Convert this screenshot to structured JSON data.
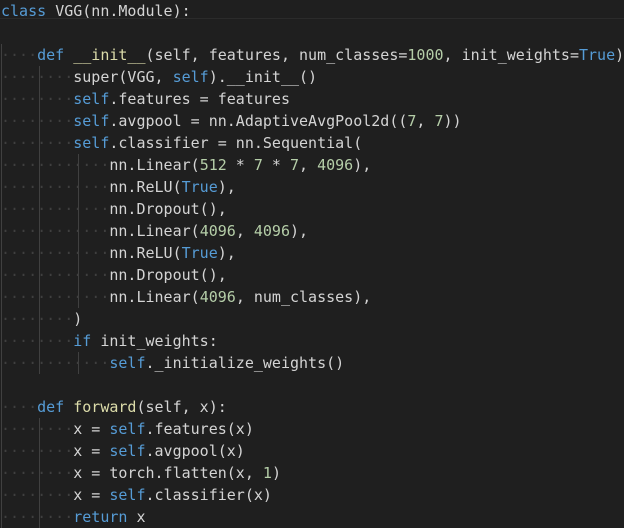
{
  "editor": {
    "app": "code-editor",
    "language": "python",
    "theme": "dark-plus",
    "background_color": "#1f1f1f",
    "default_text_color": "#d4d4d4",
    "colors": {
      "keyword": "#569cd6",
      "function": "#dcdcaa",
      "number": "#b5cea8",
      "attribute": "#9cdcfe",
      "plain": "#d4d4d4",
      "whitespace_dot": "#3f3f3f",
      "indent_guide": "#404040",
      "paren_yellow": "#d7ba7d"
    },
    "whitespace_char": "·",
    "indent_guide_columns": [
      0,
      4,
      8,
      12,
      16
    ],
    "line_count": 24
  },
  "code": {
    "lines": [
      {
        "indent": 0,
        "tokens": [
          {
            "t": "class",
            "c": "kw"
          },
          {
            "t": " ",
            "c": "pln"
          },
          {
            "t": "VGG",
            "c": "pln"
          },
          {
            "t": "(nn.Module):",
            "c": "pln"
          }
        ]
      },
      {
        "indent": 0,
        "tokens": []
      },
      {
        "indent": 4,
        "tokens": [
          {
            "t": "def",
            "c": "kw"
          },
          {
            "t": " ",
            "c": "pln"
          },
          {
            "t": "__init__",
            "c": "fn"
          },
          {
            "t": "(",
            "c": "pln"
          },
          {
            "t": "self",
            "c": "pln"
          },
          {
            "t": ", features, num_classes=",
            "c": "pln"
          },
          {
            "t": "1000",
            "c": "num"
          },
          {
            "t": ", init_weights=",
            "c": "pln"
          },
          {
            "t": "True",
            "c": "kw"
          },
          {
            "t": "):",
            "c": "pln"
          }
        ]
      },
      {
        "indent": 8,
        "tokens": [
          {
            "t": "super",
            "c": "pln"
          },
          {
            "t": "(VGG, ",
            "c": "pln"
          },
          {
            "t": "self",
            "c": "kw"
          },
          {
            "t": ").",
            "c": "pln"
          },
          {
            "t": "__init__",
            "c": "pln"
          },
          {
            "t": "()",
            "c": "pln"
          }
        ]
      },
      {
        "indent": 8,
        "tokens": [
          {
            "t": "self",
            "c": "kw"
          },
          {
            "t": ".features = features",
            "c": "pln"
          }
        ]
      },
      {
        "indent": 8,
        "tokens": [
          {
            "t": "self",
            "c": "kw"
          },
          {
            "t": ".avgpool = nn.AdaptiveAvgPool2d((",
            "c": "pln"
          },
          {
            "t": "7",
            "c": "num"
          },
          {
            "t": ", ",
            "c": "pln"
          },
          {
            "t": "7",
            "c": "num"
          },
          {
            "t": "))",
            "c": "pln"
          }
        ]
      },
      {
        "indent": 8,
        "tokens": [
          {
            "t": "self",
            "c": "kw"
          },
          {
            "t": ".classifier = nn.Sequential(",
            "c": "pln"
          }
        ]
      },
      {
        "indent": 12,
        "tokens": [
          {
            "t": "nn.Linear(",
            "c": "pln"
          },
          {
            "t": "512",
            "c": "num"
          },
          {
            "t": " * ",
            "c": "pln"
          },
          {
            "t": "7",
            "c": "num"
          },
          {
            "t": " * ",
            "c": "pln"
          },
          {
            "t": "7",
            "c": "num"
          },
          {
            "t": ", ",
            "c": "pln"
          },
          {
            "t": "4096",
            "c": "num"
          },
          {
            "t": "),",
            "c": "pln"
          }
        ]
      },
      {
        "indent": 12,
        "tokens": [
          {
            "t": "nn.ReLU(",
            "c": "pln"
          },
          {
            "t": "True",
            "c": "kw"
          },
          {
            "t": "),",
            "c": "pln"
          }
        ]
      },
      {
        "indent": 12,
        "tokens": [
          {
            "t": "nn.Dropout(),",
            "c": "pln"
          }
        ]
      },
      {
        "indent": 12,
        "tokens": [
          {
            "t": "nn.Linear(",
            "c": "pln"
          },
          {
            "t": "4096",
            "c": "num"
          },
          {
            "t": ", ",
            "c": "pln"
          },
          {
            "t": "4096",
            "c": "num"
          },
          {
            "t": "),",
            "c": "pln"
          }
        ]
      },
      {
        "indent": 12,
        "tokens": [
          {
            "t": "nn.ReLU(",
            "c": "pln"
          },
          {
            "t": "True",
            "c": "kw"
          },
          {
            "t": "),",
            "c": "pln"
          }
        ]
      },
      {
        "indent": 12,
        "tokens": [
          {
            "t": "nn.Dropout(),",
            "c": "pln"
          }
        ]
      },
      {
        "indent": 12,
        "tokens": [
          {
            "t": "nn.Linear(",
            "c": "pln"
          },
          {
            "t": "4096",
            "c": "num"
          },
          {
            "t": ", num_classes),",
            "c": "pln"
          }
        ]
      },
      {
        "indent": 8,
        "tokens": [
          {
            "t": ")",
            "c": "pln"
          }
        ]
      },
      {
        "indent": 8,
        "tokens": [
          {
            "t": "if",
            "c": "kw"
          },
          {
            "t": " init_weights:",
            "c": "pln"
          }
        ]
      },
      {
        "indent": 12,
        "tokens": [
          {
            "t": "self",
            "c": "kw"
          },
          {
            "t": "._initialize_weights()",
            "c": "pln"
          }
        ]
      },
      {
        "indent": 0,
        "tokens": []
      },
      {
        "indent": 4,
        "tokens": [
          {
            "t": "def",
            "c": "kw"
          },
          {
            "t": " ",
            "c": "pln"
          },
          {
            "t": "forward",
            "c": "fn"
          },
          {
            "t": "(",
            "c": "pln"
          },
          {
            "t": "self",
            "c": "pln"
          },
          {
            "t": ", x):",
            "c": "pln"
          }
        ]
      },
      {
        "indent": 8,
        "tokens": [
          {
            "t": "x = ",
            "c": "pln"
          },
          {
            "t": "self",
            "c": "kw"
          },
          {
            "t": ".features(x)",
            "c": "pln"
          }
        ]
      },
      {
        "indent": 8,
        "tokens": [
          {
            "t": "x = ",
            "c": "pln"
          },
          {
            "t": "self",
            "c": "kw"
          },
          {
            "t": ".avgpool(x)",
            "c": "pln"
          }
        ]
      },
      {
        "indent": 8,
        "tokens": [
          {
            "t": "x = torch.flatten(x, ",
            "c": "pln"
          },
          {
            "t": "1",
            "c": "num"
          },
          {
            "t": ")",
            "c": "pln"
          }
        ]
      },
      {
        "indent": 8,
        "tokens": [
          {
            "t": "x = ",
            "c": "pln"
          },
          {
            "t": "self",
            "c": "kw"
          },
          {
            "t": ".classifier(x)",
            "c": "pln"
          }
        ]
      },
      {
        "indent": 8,
        "tokens": [
          {
            "t": "return",
            "c": "kw"
          },
          {
            "t": " x",
            "c": "pln"
          }
        ]
      }
    ]
  }
}
